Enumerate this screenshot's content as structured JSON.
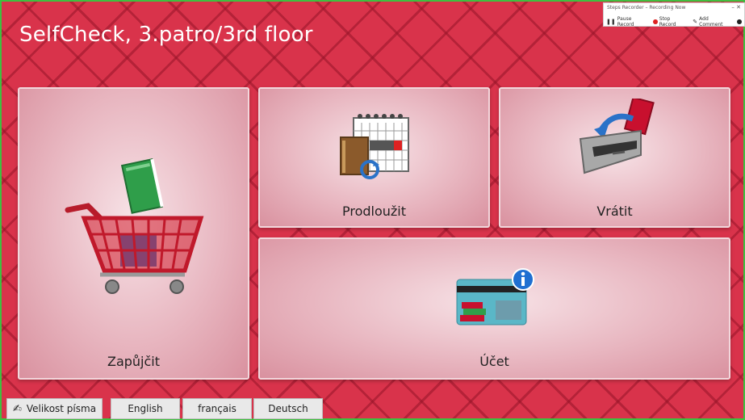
{
  "header": {
    "title": "SelfCheck, 3.patro/3rd floor"
  },
  "tiles": {
    "borrow": {
      "label": "Zapůjčit",
      "icon": "shopping-basket-book-icon"
    },
    "renew": {
      "label": "Prodloužit",
      "icon": "calendar-book-renew-icon"
    },
    "return": {
      "label": "Vrátit",
      "icon": "return-slot-icon"
    },
    "account": {
      "label": "Účet",
      "icon": "library-card-info-icon"
    }
  },
  "bottom_bar": {
    "font_size_label": "Velikost písma",
    "languages": [
      "English",
      "français",
      "Deutsch"
    ]
  },
  "recorder": {
    "title": "Steps Recorder – Recording Now",
    "window_controls": "–  ✕",
    "pause_label": "Pause Record",
    "stop_label": "Stop Record",
    "comment_label": "Add Comment"
  },
  "colors": {
    "background": "#d9334b",
    "tile_fill": "#f7e3e7",
    "frame": "#3fbf3f"
  }
}
